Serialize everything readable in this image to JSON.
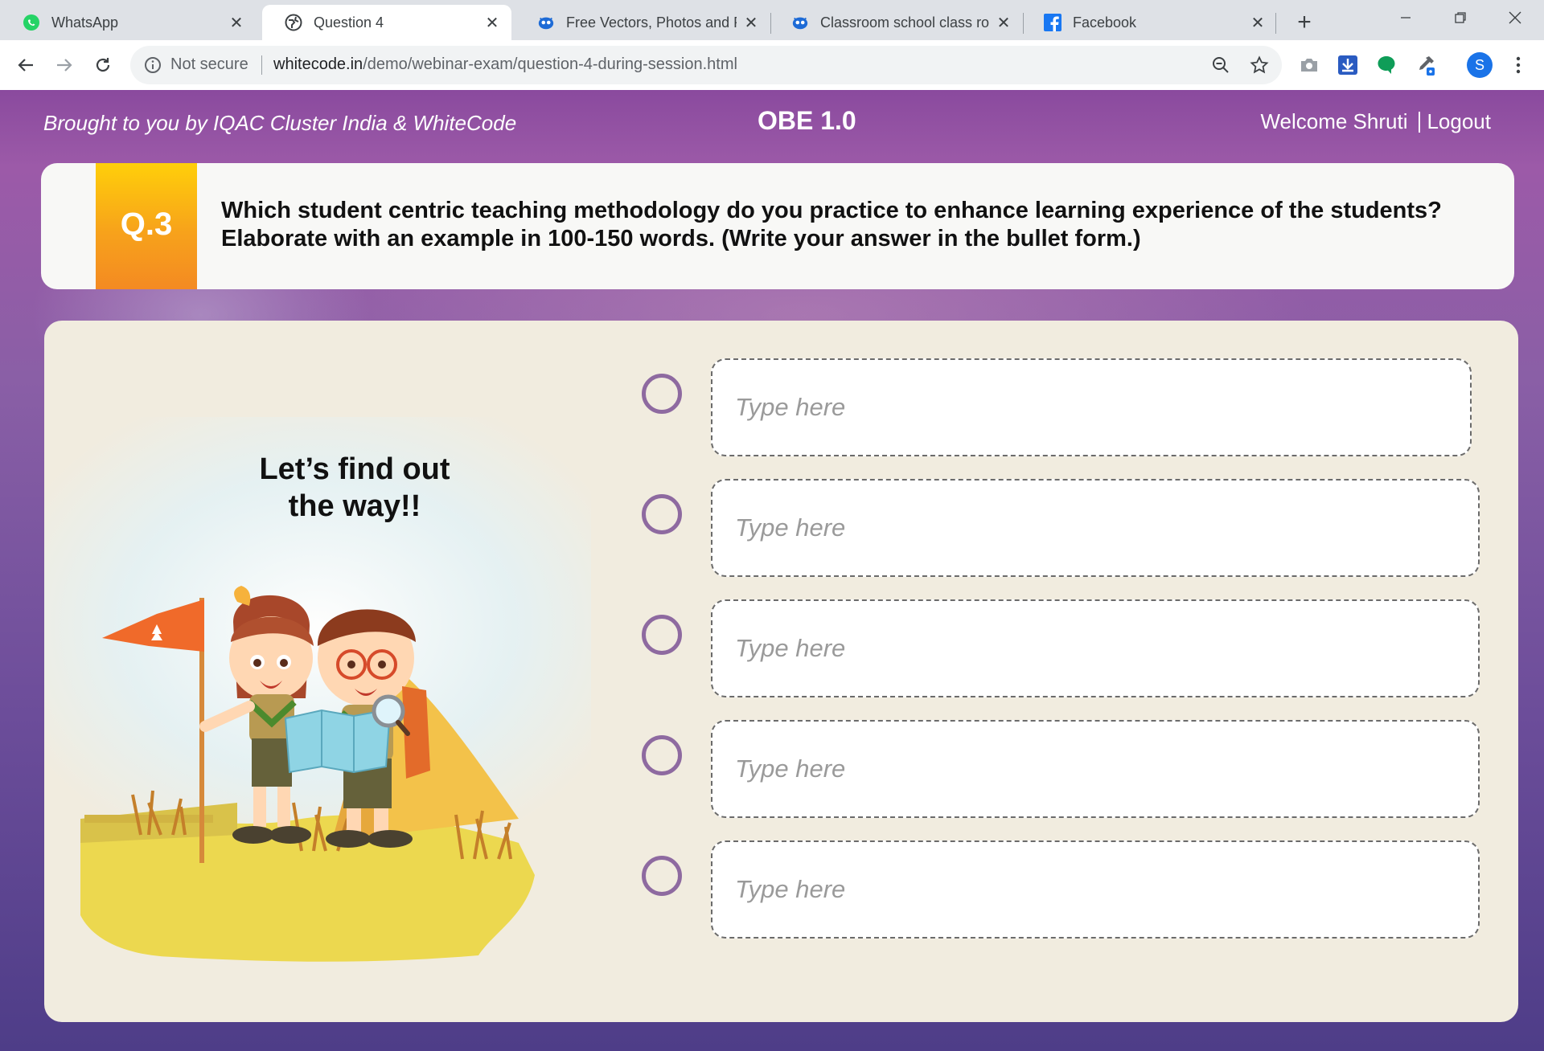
{
  "browser": {
    "tabs": [
      {
        "title": "WhatsApp",
        "icon": "whatsapp-icon",
        "active": false
      },
      {
        "title": "Question 4",
        "icon": "globe-icon",
        "active": true
      },
      {
        "title": "Free Vectors, Photos and PS",
        "icon": "freepik-icon",
        "active": false
      },
      {
        "title": "Classroom school class roo",
        "icon": "freepik-icon",
        "active": false
      },
      {
        "title": "Facebook",
        "icon": "facebook-icon",
        "active": false
      }
    ],
    "security_label": "Not secure",
    "url_host": "whitecode.in",
    "url_path": "/demo/webinar-exam/question-4-during-session.html",
    "profile_initial": "S"
  },
  "header": {
    "brought_by": "Brought to you by IQAC Cluster India  & WhiteCode",
    "app_title": "OBE 1.0",
    "welcome": "Welcome Shruti",
    "logout": "Logout"
  },
  "question": {
    "number": "Q.3",
    "text": "Which student centric teaching methodology do you practice to enhance learning experience of the students? Elaborate with an example in 100-150 words. (Write your answer in the bullet form.)"
  },
  "illustration": {
    "caption_line1": "Let’s find out",
    "caption_line2": "the way!!"
  },
  "answers": [
    {
      "placeholder": "Type here",
      "value": ""
    },
    {
      "placeholder": "Type here",
      "value": ""
    },
    {
      "placeholder": "Type here",
      "value": ""
    },
    {
      "placeholder": "Type here",
      "value": ""
    },
    {
      "placeholder": "Type here",
      "value": ""
    }
  ],
  "colors": {
    "badge_gradient_top": "#ffcf0a",
    "badge_gradient_bottom": "#f48a22",
    "radio_ring": "#8e6aa0",
    "panel_bg": "#f1ecdf",
    "page_bg_top": "#8a4a9e",
    "page_bg_bottom": "#4e3d88"
  }
}
